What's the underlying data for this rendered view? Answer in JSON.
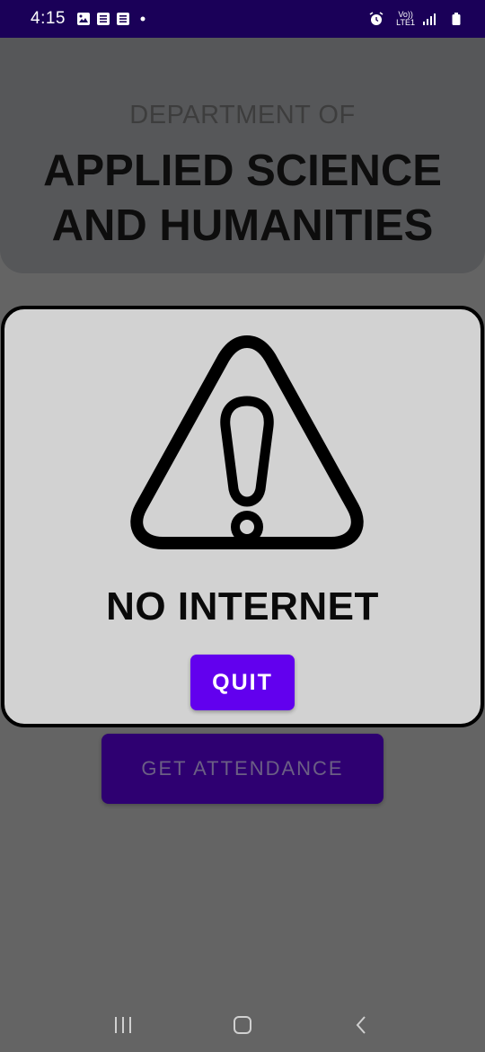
{
  "status_bar": {
    "time": "4:15",
    "network_label_top": "Vo))",
    "network_label_bottom": "LTE1",
    "icons": [
      "gallery-icon",
      "note-icon",
      "note-icon",
      "dot-icon",
      "alarm-icon",
      "signal-icon",
      "battery-icon"
    ]
  },
  "header": {
    "subtitle": "DEPARTMENT OF",
    "title_line1": "APPLIED SCIENCE",
    "title_line2": "AND HUMANITIES"
  },
  "main": {
    "attendance_button_label": "GET ATTENDANCE"
  },
  "dialog": {
    "icon": "warning-icon",
    "title": "NO INTERNET",
    "quit_label": "QUIT"
  },
  "navigation": {
    "icons": [
      "recent-apps-icon",
      "home-icon",
      "back-icon"
    ]
  },
  "colors": {
    "status_bar": "#1a0058",
    "accent": "#6200ee",
    "dim_button": "#2e0071",
    "dialog_bg": "#d2d2d2"
  }
}
